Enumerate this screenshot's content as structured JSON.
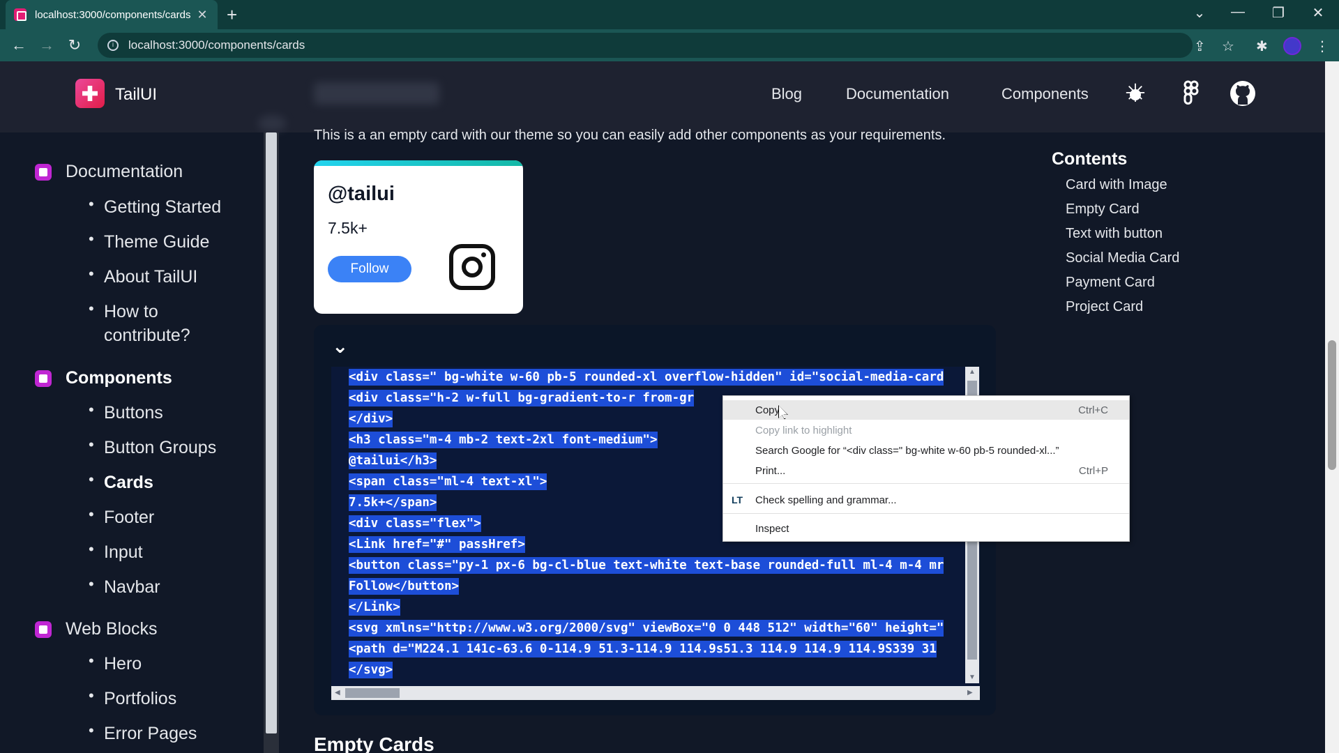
{
  "browser": {
    "tab_title": "localhost:3000/components/cards",
    "tab_close": "✕",
    "new_tab": "+",
    "url": "localhost:3000/components/cards",
    "back": "←",
    "forward": "→",
    "reload": "↻",
    "tab_list": "⌄",
    "minimize": "—",
    "restore": "❐",
    "close": "✕",
    "share": "⇪",
    "star": "☆",
    "extensions": "✱",
    "menu": "⋮"
  },
  "site": {
    "logo_text": "TailUI",
    "nav": [
      "Blog",
      "Documentation",
      "Components"
    ]
  },
  "sidebar": {
    "sections": [
      {
        "label": "Documentation",
        "items": [
          "Getting Started",
          "Theme Guide",
          "About TailUI",
          "How to contribute?"
        ]
      },
      {
        "label": "Components",
        "items": [
          "Buttons",
          "Button Groups",
          "Cards",
          "Footer",
          "Input",
          "Navbar"
        ]
      },
      {
        "label": "Web Blocks",
        "items": [
          "Hero",
          "Portfolios",
          "Error Pages"
        ]
      }
    ],
    "active_item": "Cards"
  },
  "main": {
    "intro": "This is a an empty card with our theme so you can easily add other components as your requirements.",
    "card": {
      "handle": "@tailui",
      "count": "7.5k+",
      "follow_label": "Follow"
    },
    "code_lines": [
      "<div class=\" bg-white w-60 pb-5 rounded-xl overflow-hidden\" id=\"social-media-card",
      "<div class=\"h-2 w-full bg-gradient-to-r from-gr",
      "</div>",
      "<h3 class=\"m-4 mb-2 text-2xl font-medium\">",
      "@tailui</h3>",
      "<span class=\"ml-4 text-xl\">",
      "7.5k+</span>",
      "<div class=\"flex\">",
      "<Link href=\"#\" passHref>",
      "<button class=\"py-1 px-6 bg-cl-blue text-white text-base rounded-full ml-4 m-4 mr",
      "Follow</button>",
      "</Link>",
      "<svg xmlns=\"http://www.w3.org/2000/svg\" viewBox=\"0 0 448 512\" width=\"60\" height=\"",
      "<path d=\"M224.1 141c-63.6 0-114.9 51.3-114.9 114.9s51.3 114.9 114.9 114.9S339 31",
      "</svg>"
    ],
    "next_heading": "Empty Cards"
  },
  "toc": {
    "title": "Contents",
    "items": [
      "Card with Image",
      "Empty Card",
      "Text with button",
      "Social Media Card",
      "Payment Card",
      "Project Card"
    ]
  },
  "context_menu": {
    "items": [
      {
        "label": "Copy",
        "shortcut": "Ctrl+C"
      },
      {
        "label": "Copy link to highlight",
        "shortcut": ""
      },
      {
        "label": "Search Google for “<div class=\" bg-white w-60 pb-5 rounded-xl...”",
        "shortcut": ""
      },
      {
        "label": "Print...",
        "shortcut": "Ctrl+P"
      },
      {
        "label": "Check spelling and grammar...",
        "shortcut": ""
      },
      {
        "label": "Inspect",
        "shortcut": ""
      }
    ],
    "lt_icon": "LT"
  }
}
